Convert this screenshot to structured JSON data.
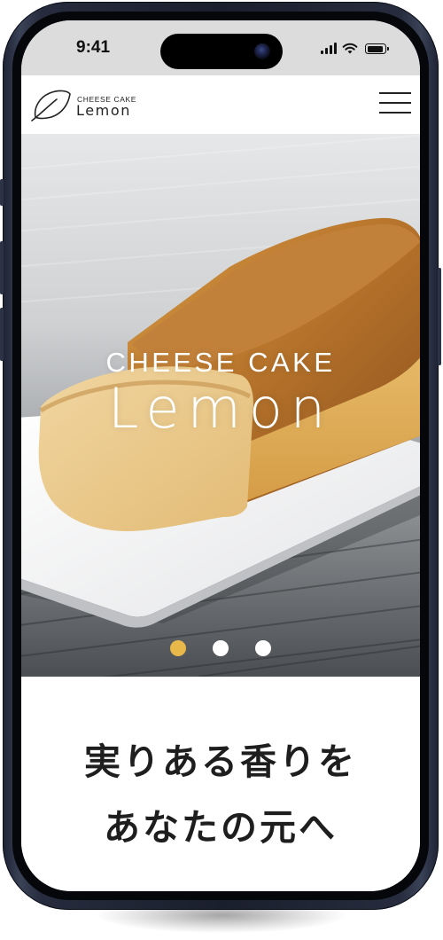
{
  "status_bar": {
    "time": "9:41",
    "icons": [
      "signal-icon",
      "wifi-icon",
      "battery-icon"
    ]
  },
  "header": {
    "logo": {
      "top": "CHEESE CAKE",
      "bottom": "Lemon"
    },
    "menu_icon": "hamburger-menu-icon"
  },
  "hero": {
    "image": "cheesecake-photo",
    "title_top": "CHEESE CAKE",
    "title_bottom": "Lemon",
    "carousel": {
      "total": 3,
      "active": 1
    }
  },
  "tagline": {
    "line1": "実りある香りを",
    "line2": "あなたの元へ"
  },
  "colors": {
    "accent": "#e8b94a",
    "text": "#1e1e1e",
    "frame": "#1f2434"
  }
}
